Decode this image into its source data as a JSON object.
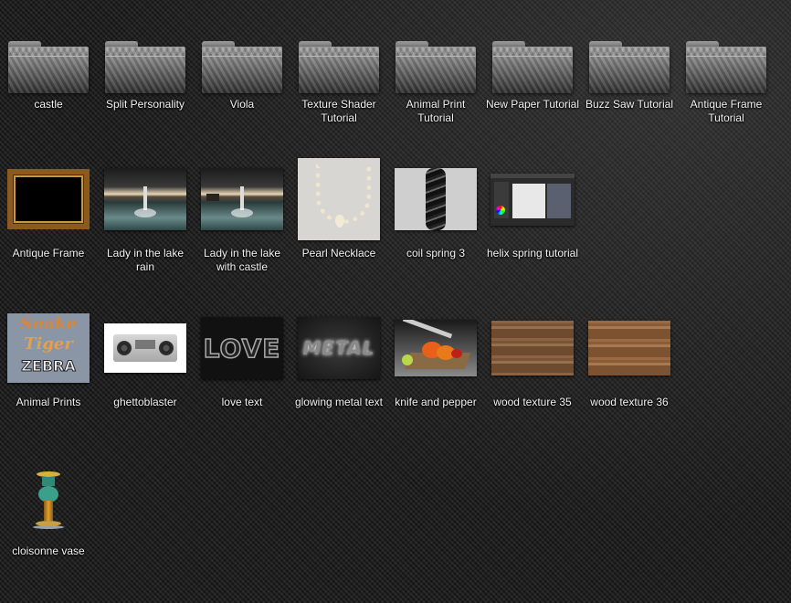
{
  "folders": [
    {
      "label": "castle"
    },
    {
      "label": "Split Personality"
    },
    {
      "label": "Viola"
    },
    {
      "label": "Texture Shader Tutorial"
    },
    {
      "label": "Animal Print Tutorial"
    },
    {
      "label": "New Paper Tutorial"
    },
    {
      "label": "Buzz Saw Tutorial"
    },
    {
      "label": "Antique Frame Tutorial"
    }
  ],
  "images": [
    {
      "label": "Antique Frame",
      "icon": "antique-frame-thumbnail"
    },
    {
      "label": "Lady in the lake rain",
      "icon": "lake-rain-thumbnail"
    },
    {
      "label": "Lady in the lake with castle",
      "icon": "lake-castle-thumbnail"
    },
    {
      "label": "Pearl Necklace",
      "icon": "pearl-necklace-thumbnail"
    },
    {
      "label": "coil spring 3",
      "icon": "coil-spring-thumbnail"
    },
    {
      "label": "helix spring tutorial",
      "icon": "helix-tutorial-thumbnail"
    },
    {
      "label": "Animal Prints",
      "icon": "animal-prints-thumbnail",
      "thumb_text": [
        "Snake",
        "Tiger",
        "ZEBRA"
      ]
    },
    {
      "label": "ghettoblaster",
      "icon": "ghettoblaster-thumbnail"
    },
    {
      "label": "love text",
      "icon": "love-text-thumbnail",
      "thumb_text": "LOVE"
    },
    {
      "label": "glowing metal text",
      "icon": "metal-text-thumbnail",
      "thumb_text": "METAL"
    },
    {
      "label": "knife and pepper",
      "icon": "knife-pepper-thumbnail"
    },
    {
      "label": "wood texture 35",
      "icon": "wood-texture-thumbnail"
    },
    {
      "label": "wood texture 36",
      "icon": "wood-texture-thumbnail"
    },
    {
      "label": "cloisonne vase",
      "icon": "cloisonne-vase-thumbnail"
    }
  ],
  "colors": {
    "label_text": "#f2f2f2",
    "background": "#1c1c1c"
  }
}
